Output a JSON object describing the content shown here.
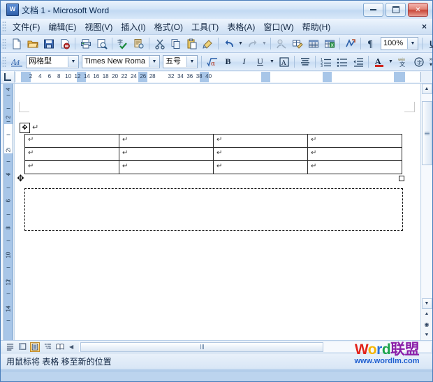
{
  "window": {
    "title": "文档 1 - Microsoft Word",
    "app_icon": "word-document-icon",
    "minimize_label": "最小化",
    "restore_label": "还原",
    "close_label": "关闭"
  },
  "menubar": {
    "items": [
      {
        "label": "文件(F)",
        "name": "menu-file"
      },
      {
        "label": "编辑(E)",
        "name": "menu-edit"
      },
      {
        "label": "视图(V)",
        "name": "menu-view"
      },
      {
        "label": "插入(I)",
        "name": "menu-insert"
      },
      {
        "label": "格式(O)",
        "name": "menu-format"
      },
      {
        "label": "工具(T)",
        "name": "menu-tools"
      },
      {
        "label": "表格(A)",
        "name": "menu-table"
      },
      {
        "label": "窗口(W)",
        "name": "menu-window"
      },
      {
        "label": "帮助(H)",
        "name": "menu-help"
      }
    ],
    "close_document_label": "×"
  },
  "standard_toolbar": {
    "buttons": [
      {
        "icon": "new-document-icon",
        "label": "新建空白文档"
      },
      {
        "icon": "open-folder-icon",
        "label": "打开"
      },
      {
        "icon": "save-disk-icon",
        "label": "保存"
      },
      {
        "icon": "mail-recipient-icon",
        "label": "电子邮件"
      },
      {
        "icon": "print-icon",
        "label": "打印"
      },
      {
        "icon": "print-preview-icon",
        "label": "打印预览"
      },
      {
        "icon": "spelling-check-icon",
        "label": "拼写和语法"
      },
      {
        "icon": "research-icon",
        "label": "信息检索"
      },
      {
        "icon": "cut-scissors-icon",
        "label": "剪切"
      },
      {
        "icon": "copy-icon",
        "label": "复制"
      },
      {
        "icon": "paste-clipboard-icon",
        "label": "粘贴"
      },
      {
        "icon": "format-painter-brush-icon",
        "label": "格式刷"
      },
      {
        "icon": "undo-arrow-icon",
        "label": "撤消"
      },
      {
        "icon": "redo-arrow-icon",
        "label": "恢复"
      },
      {
        "icon": "insert-hyperlink-icon",
        "label": "插入超链接"
      },
      {
        "icon": "tables-and-borders-icon",
        "label": "表格和边框"
      },
      {
        "icon": "insert-table-icon",
        "label": "插入表格"
      },
      {
        "icon": "insert-excel-sheet-icon",
        "label": "插入 Excel 电子表格"
      },
      {
        "icon": "columns-icon",
        "label": "分栏"
      },
      {
        "icon": "show-formatting-marks-icon",
        "label": "显示/隐藏编辑标记"
      }
    ],
    "zoom_value": "100%",
    "zoom_name": "zoom-combo",
    "underline_label": "U",
    "overflow_label": "工具栏选项"
  },
  "formatting_toolbar": {
    "style_icon": "style-aa-icon",
    "style_value": "网格型",
    "font_value": "Times New Roma",
    "size_value": "五号",
    "buttons": [
      {
        "icon": "math-formula-icon",
        "label": "公式"
      },
      {
        "icon": "bold-icon",
        "label": "B"
      },
      {
        "icon": "italic-icon",
        "label": "I"
      },
      {
        "icon": "underline-icon",
        "label": "U"
      },
      {
        "icon": "character-border-icon",
        "label": "字符边框"
      },
      {
        "icon": "align-distributed-icon",
        "label": "分散对齐"
      },
      {
        "icon": "numbered-list-icon",
        "label": "编号"
      },
      {
        "icon": "bulleted-list-icon",
        "label": "项目符号"
      },
      {
        "icon": "decrease-indent-icon",
        "label": "减少缩进量"
      },
      {
        "icon": "font-color-icon",
        "label": "字体颜色"
      },
      {
        "icon": "phonetic-guide-icon",
        "label": "拼音指南"
      },
      {
        "icon": "enclose-character-icon",
        "label": "带圈字符"
      }
    ],
    "overflow_label": "工具栏选项"
  },
  "ruler": {
    "tab_stop_icon": "left-tab-stop-icon",
    "h_numbers": [
      "2",
      "4",
      "6",
      "8",
      "10",
      "12",
      "14",
      "16",
      "18",
      "20",
      "22",
      "24",
      "26",
      "28",
      "32",
      "34",
      "36",
      "38",
      "40"
    ],
    "v_numbers": [
      "4",
      "2",
      "2",
      "4",
      "6",
      "8",
      "10",
      "12",
      "14"
    ]
  },
  "document": {
    "table": {
      "rows": 3,
      "columns": 4,
      "cell_mark": "↵",
      "move_handle_icon": "table-move-handle-icon",
      "resize_handle_name": "table-resize-handle"
    },
    "paragraph_mark": "↵",
    "drag_cursor_icon": "move-cursor-icon",
    "drop_target_name": "table-drop-preview"
  },
  "scrollbars": {
    "up_arrow": "▲",
    "down_arrow": "▼",
    "left_arrow": "◀",
    "right_arrow": "▶",
    "prev_object": "⯅",
    "select_object": "◉",
    "next_object": "⯆"
  },
  "view_buttons": [
    {
      "icon": "normal-view-icon",
      "label": "普通视图",
      "active": false
    },
    {
      "icon": "web-layout-view-icon",
      "label": "Web 版式视图",
      "active": false
    },
    {
      "icon": "print-layout-view-icon",
      "label": "页面视图",
      "active": true
    },
    {
      "icon": "outline-view-icon",
      "label": "大纲视图",
      "active": false
    },
    {
      "icon": "reading-layout-view-icon",
      "label": "阅读版式",
      "active": false
    }
  ],
  "statusbar": {
    "text": "用鼠标将 表格 移至新的位置"
  },
  "watermark": {
    "w": "W",
    "o": "o",
    "r": "r",
    "d": "d",
    "cn": "联盟",
    "url": "www.wordlm.com"
  }
}
